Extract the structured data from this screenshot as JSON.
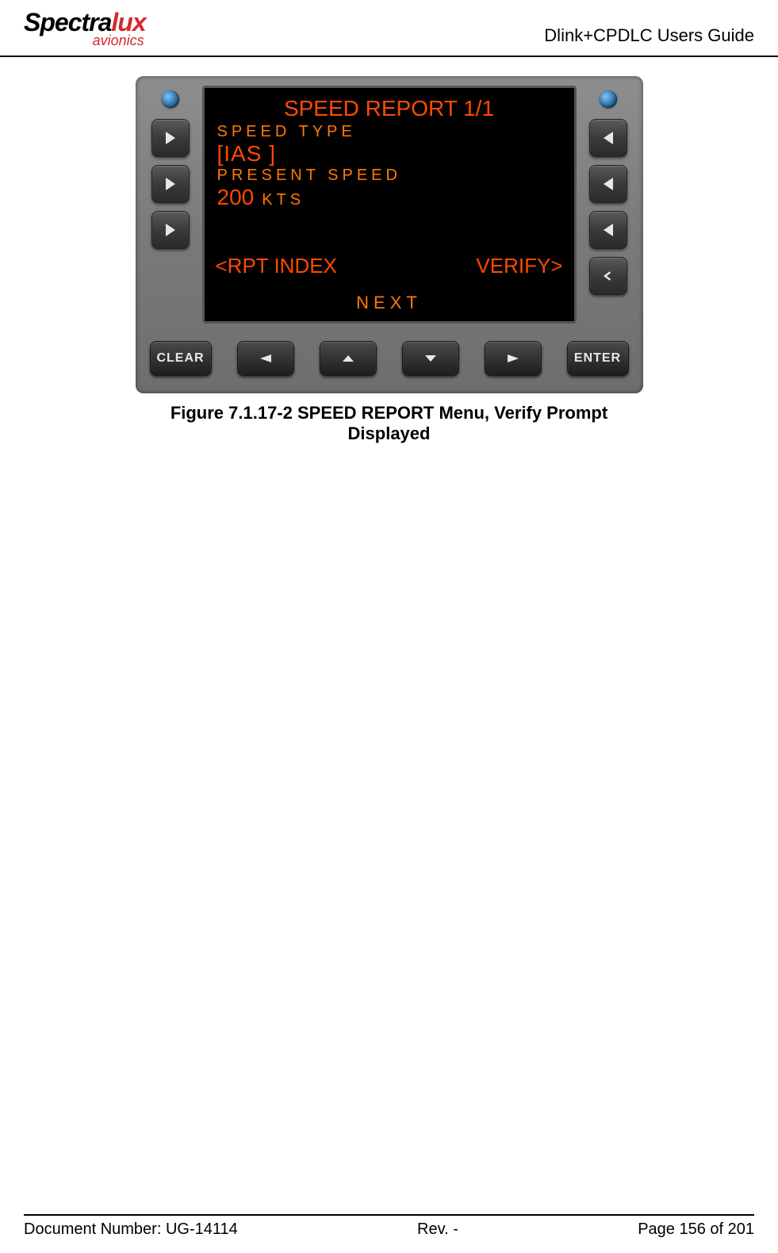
{
  "header": {
    "logo_main_a": "Spectra",
    "logo_main_b": "lux",
    "logo_sub": "avionics",
    "title": "Dlink+CPDLC Users Guide"
  },
  "screen": {
    "title": "SPEED REPORT  1/1",
    "label_type": "SPEED TYPE",
    "value_ias": "[IAS ]",
    "label_present": "PRESENT SPEED",
    "value_speed": "200",
    "unit_speed": "KTS",
    "action_left": "<RPT INDEX",
    "action_right": "VERIFY>",
    "next": "NEXT"
  },
  "buttons": {
    "clear": "CLEAR",
    "enter": "ENTER"
  },
  "caption": "Figure 7.1.17-2 SPEED REPORT Menu, Verify Prompt Displayed",
  "footer": {
    "doc": "Document Number:  UG-14114",
    "rev": "Rev. -",
    "page": "Page 156 of 201"
  }
}
